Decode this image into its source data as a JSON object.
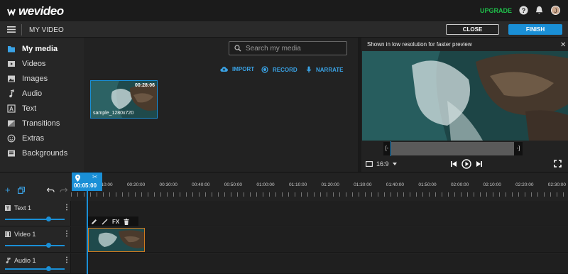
{
  "app": {
    "logo": "wevideo",
    "upgrade_label": "UPGRADE",
    "avatar_initial": "J"
  },
  "header": {
    "project_title": "MY VIDEO",
    "close_label": "CLOSE",
    "finish_label": "FINISH"
  },
  "sidebar": {
    "items": [
      {
        "label": "My media",
        "icon": "folder-icon",
        "active": true
      },
      {
        "label": "Videos",
        "icon": "video-icon"
      },
      {
        "label": "Images",
        "icon": "image-icon"
      },
      {
        "label": "Audio",
        "icon": "music-note-icon"
      },
      {
        "label": "Text",
        "icon": "text-icon"
      },
      {
        "label": "Transitions",
        "icon": "transitions-icon"
      },
      {
        "label": "Extras",
        "icon": "smiley-icon"
      },
      {
        "label": "Backgrounds",
        "icon": "backgrounds-icon"
      }
    ]
  },
  "media": {
    "search_placeholder": "Search my media",
    "actions": {
      "import": "IMPORT",
      "record": "RECORD",
      "narrate": "NARRATE"
    },
    "items": [
      {
        "name": "sample_1280x720",
        "duration": "00:28:06"
      }
    ]
  },
  "preview": {
    "banner": "Shown in low resolution for faster preview",
    "aspect_ratio": "16:9",
    "scrub_in": "[-",
    "scrub_out": "-]"
  },
  "timeline": {
    "playhead_time": "00:05:00",
    "ruler_labels": [
      "00:10:00",
      "00:20:00",
      "00:30:00",
      "00:40:00",
      "00:50:00",
      "01:00:00",
      "01:10:00",
      "01:20:00",
      "01:30:00",
      "01:40:00",
      "01:50:00",
      "02:00:00",
      "02:10:00",
      "02:20:00",
      "02:30:00"
    ],
    "tracks": [
      {
        "name": "Text 1",
        "icon": "text-track-icon"
      },
      {
        "name": "Video 1",
        "icon": "video-track-icon"
      },
      {
        "name": "Audio 1",
        "icon": "audio-track-icon"
      }
    ],
    "clip_tools": {
      "fx": "FX"
    }
  },
  "colors": {
    "accent": "#1a8fd6",
    "upgrade": "#1fbf4a",
    "clip_border": "#d07a1f"
  }
}
